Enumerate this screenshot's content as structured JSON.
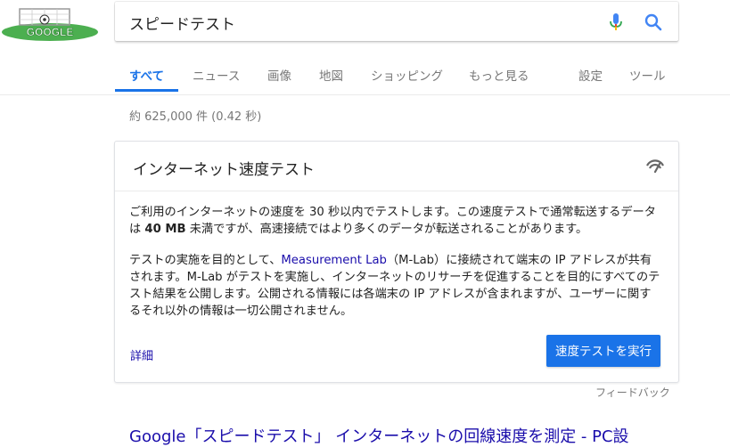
{
  "search": {
    "query": "スピードテスト"
  },
  "tabs": [
    {
      "label": "すべて"
    },
    {
      "label": "ニュース"
    },
    {
      "label": "画像"
    },
    {
      "label": "地図"
    },
    {
      "label": "ショッピング"
    },
    {
      "label": "もっと見る"
    },
    {
      "label": "設定"
    },
    {
      "label": "ツール"
    }
  ],
  "active_tab": "すべて",
  "result_stats": "約 625,000 件  (0.42 秒)",
  "card": {
    "title": "インターネット速度テスト",
    "p1_a": "ご利用のインターネットの速度を 30 秒以内でテストします。この速度テストで通常転送するデータは ",
    "p1_bold": "40 MB",
    "p1_b": " 未満ですが、高速接続ではより多くのデータが転送されることがあります。",
    "p2_a": "テストの実施を目的として、",
    "p2_link": "Measurement Lab",
    "p2_b": "（M-Lab）に接続されて端末の IP アドレスが共有されます。M-Lab がテストを実施し、インターネットのリサーチを促進することを目的にすべてのテスト結果を公開します。公開される情報には各端末の IP アドレスが含まれますが、ユーザーに関するそれ以外の情報は一切公開されません。",
    "details_label": "詳細",
    "run_label": "速度テストを実行"
  },
  "feedback_label": "フィードバック",
  "next_result_title": "Google「スピードテスト」 インターネットの回線速度を測定 - PC設",
  "colors": {
    "accent": "#1a73e8",
    "link": "#1a0dab",
    "muted": "#777777"
  }
}
